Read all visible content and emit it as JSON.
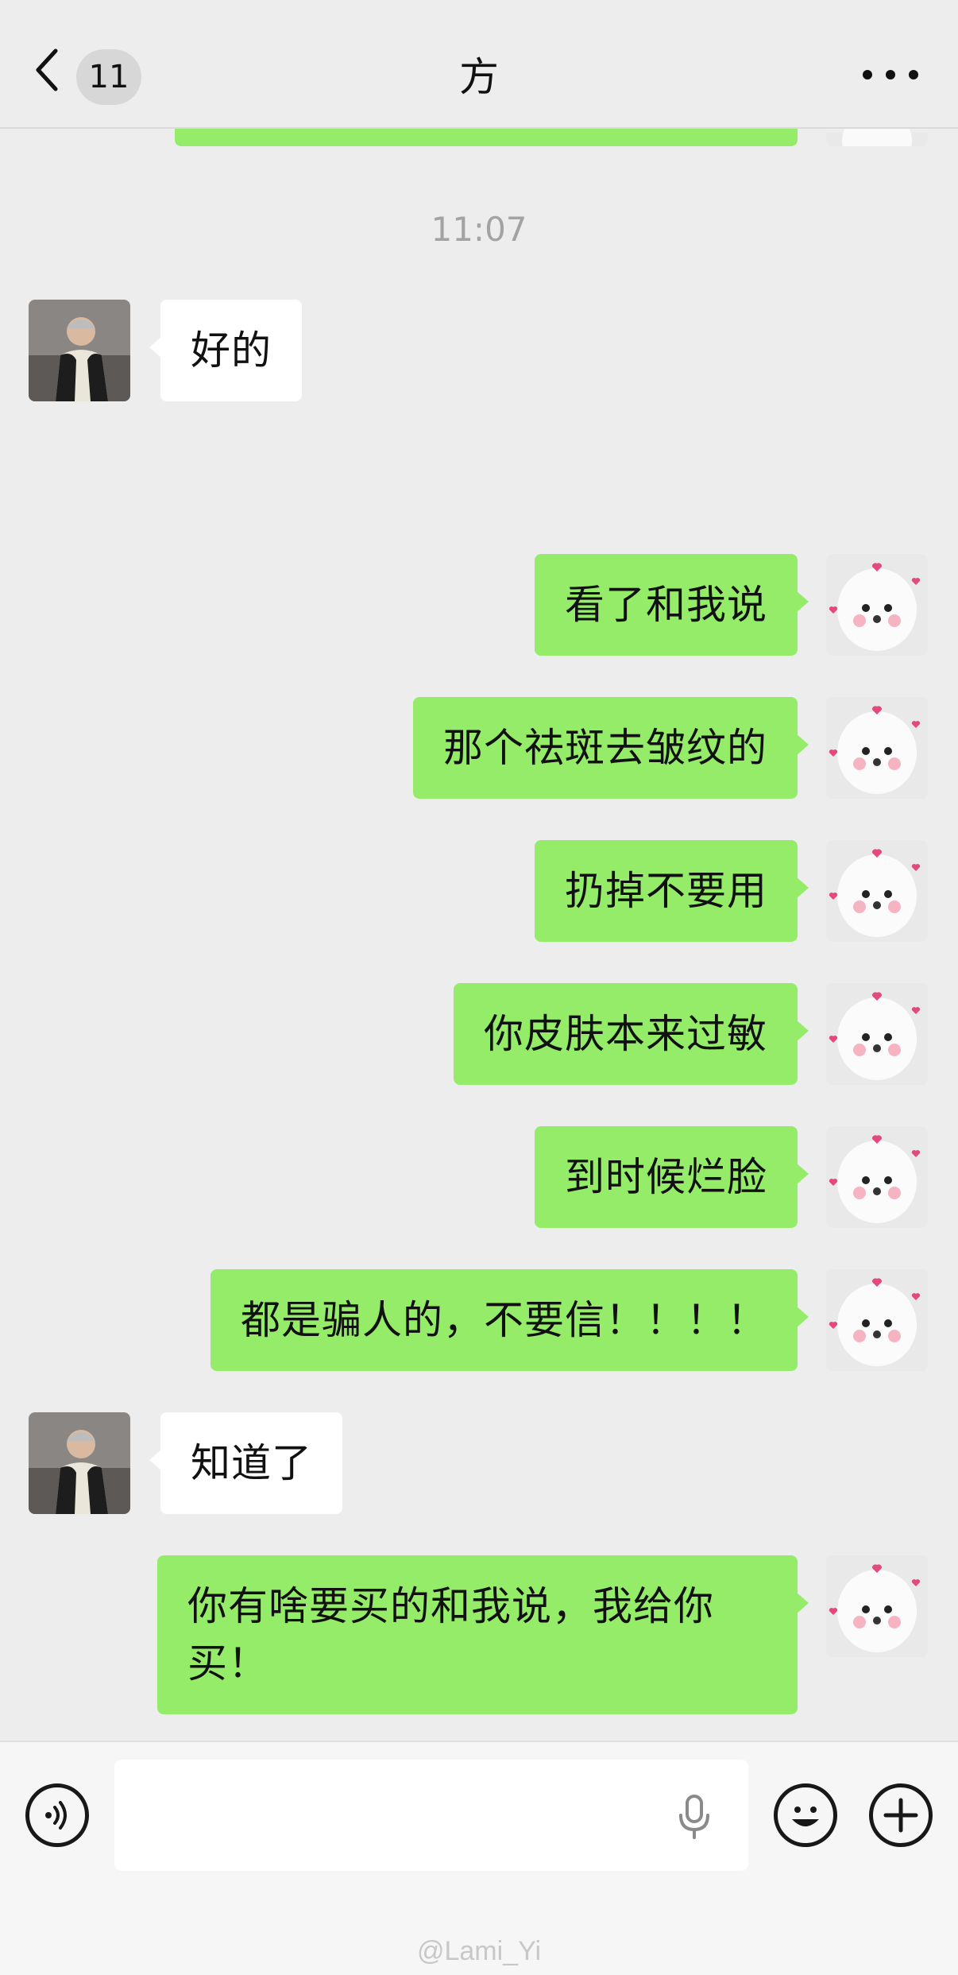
{
  "header": {
    "unread_count": "11",
    "title": "方"
  },
  "chat": {
    "timestamp": "11:07",
    "messages": [
      {
        "from": "them",
        "text": "好的"
      },
      {
        "from": "me",
        "text": "看了和我说"
      },
      {
        "from": "me",
        "text": "那个祛斑去皱纹的"
      },
      {
        "from": "me",
        "text": "扔掉不要用"
      },
      {
        "from": "me",
        "text": "你皮肤本来过敏"
      },
      {
        "from": "me",
        "text": "到时候烂脸"
      },
      {
        "from": "me",
        "text": "都是骗人的，不要信！！！！"
      },
      {
        "from": "them",
        "text": "知道了"
      },
      {
        "from": "me",
        "text": "你有啥要买的和我说，我给你买！"
      }
    ]
  },
  "input_bar": {
    "text_value": "",
    "watermark": "@Lami_Yi"
  },
  "icons": {
    "back": "chevron-left-icon",
    "more": "more-dots-icon",
    "voice": "voice-icon",
    "mic": "microphone-icon",
    "emoji": "emoji-icon",
    "plus": "plus-icon"
  },
  "colors": {
    "background": "#ededed",
    "my_bubble": "#95ec69",
    "their_bubble": "#ffffff",
    "timestamp": "#a3a3a3"
  }
}
